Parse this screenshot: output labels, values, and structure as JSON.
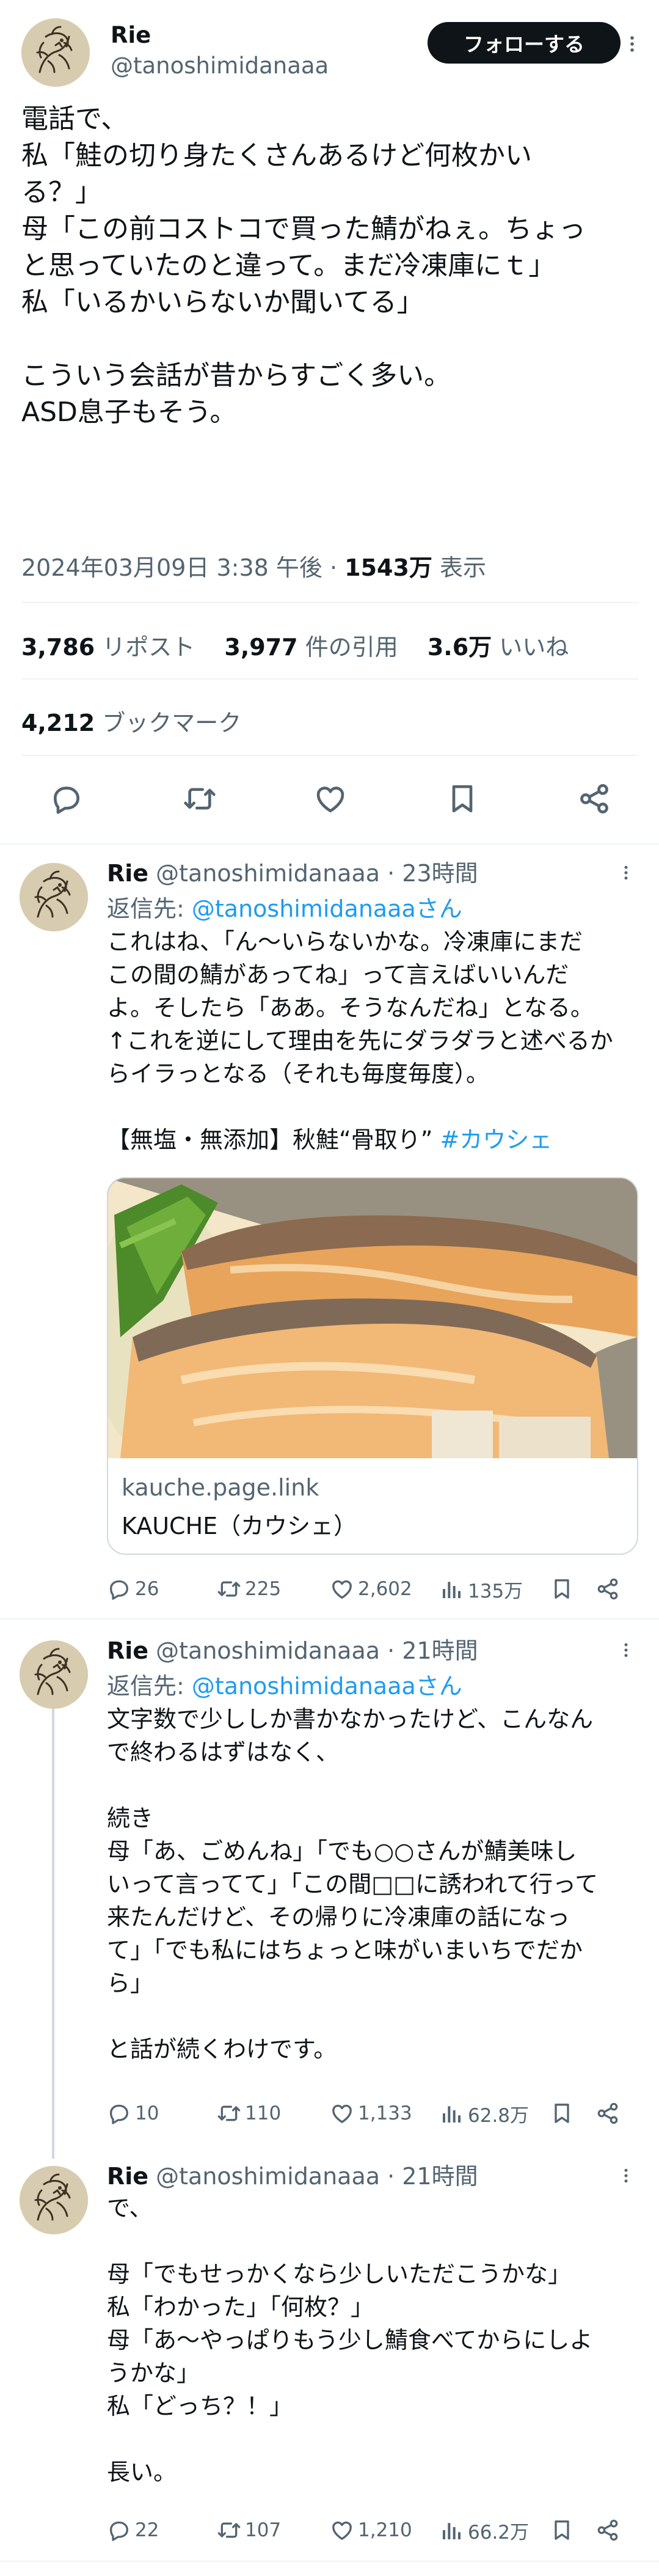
{
  "main_tweet": {
    "display_name": "Rie",
    "handle": "@tanoshimidanaaa",
    "follow_label": "フォローする",
    "body_lines": [
      "電話で、",
      "私「鮭の切り身たくさんあるけど何枚かい",
      "る？」",
      "母「この前コストコで買った鯖がねぇ。ちょっ",
      "と思っていたのと違って。まだ冷凍庫にｔ」",
      "私「いるかいらないか聞いてる」",
      "",
      "こういう会話が昔からすごく多い。",
      "ASD息子もそう。"
    ],
    "timestamp": "2024年03月09日 3:38 午後",
    "views_count": "1543万",
    "views_label": "表示",
    "reposts_count": "3,786",
    "reposts_label": "リポスト",
    "quotes_count": "3,977",
    "quotes_label": "件の引用",
    "likes_count": "3.6万",
    "likes_label": "いいね",
    "bookmarks_count": "4,212",
    "bookmarks_label": "ブックマーク",
    "action_icons": [
      "reply-icon",
      "repost-icon",
      "like-icon",
      "bookmark-icon",
      "share-icon"
    ]
  },
  "replies": [
    {
      "display_name": "Rie",
      "handle_time": "@tanoshimidanaaa · 23時間",
      "reply_to_prefix": "返信先: ",
      "reply_to_handle": "@tanoshimidanaaaさん",
      "body_lines": [
        "これはね、「ん〜いらないかな。冷凍庫にまだ",
        "この間の鯖があってね」って言えばいいんだ",
        "よ。そしたら「ああ。そうなんだね」となる。",
        "↑これを逆にして理由を先にダラダラと述べるか",
        "らイラっとなる（それも毎度毎度）。",
        "",
        "【無塩・無添加】秋鮭“骨取り”"
      ],
      "hashtag": "#カウシェ",
      "card": {
        "domain": "kauche.page.link",
        "title": "KAUCHE（カウシェ）"
      },
      "replies_count": "26",
      "reposts_count": "225",
      "likes_count": "2,602",
      "views_count": "135万"
    },
    {
      "display_name": "Rie",
      "handle_time": "@tanoshimidanaaa · 21時間",
      "reply_to_prefix": "返信先: ",
      "reply_to_handle": "@tanoshimidanaaaさん",
      "body_lines": [
        "文字数で少ししか書かなかったけど、こんなん",
        "で終わるはずはなく、",
        "",
        "続き",
        "母「あ、ごめんね」「でも○○さんが鯖美味し",
        "いって言ってて」「この間□□に誘われて行って",
        "来たんだけど、その帰りに冷凍庫の話になっ",
        "て」「でも私にはちょっと味がいまいちでだか",
        "ら」",
        "",
        "と話が続くわけです。"
      ],
      "replies_count": "10",
      "reposts_count": "110",
      "likes_count": "1,133",
      "views_count": "62.8万"
    },
    {
      "display_name": "Rie",
      "handle_time": "@tanoshimidanaaa · 21時間",
      "body_lines": [
        "で、",
        "",
        "母「でもせっかくなら少しいただこうかな」",
        "私「わかった」「何枚？」",
        "母「あ〜やっぱりもう少し鯖食べてからにしよ",
        "うかな」",
        "私「どっち？！」",
        "",
        "長い。"
      ],
      "replies_count": "22",
      "reposts_count": "107",
      "likes_count": "1,210",
      "views_count": "66.2万"
    }
  ],
  "colors": {
    "text": "#0f1419",
    "secondary": "#536471",
    "link": "#1d9bf0",
    "divider": "#eff3f4"
  }
}
